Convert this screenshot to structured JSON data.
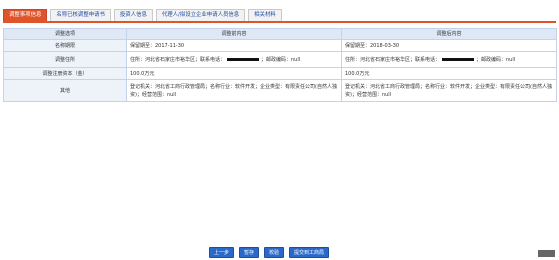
{
  "tabs": [
    {
      "label": "调整事项信息",
      "active": true
    },
    {
      "label": "名称已核调整申请书",
      "active": false
    },
    {
      "label": "投资人信息",
      "active": false
    },
    {
      "label": "代理人/拟设立企业申请人员信息",
      "active": false
    },
    {
      "label": "相关材料",
      "active": false
    }
  ],
  "table": {
    "col_item": "调整选项",
    "col_before": "调整前内容",
    "col_after": "调整后内容",
    "rows": [
      {
        "label": "名称期限",
        "before": "保留期至：2017-11-30",
        "after": "保留期至：2018-03-30"
      },
      {
        "label": "调整住所",
        "before_a": "住所：河北省石家庄市裕华区；联系电话：",
        "before_b": "；邮政编码：null",
        "after_a": "住所：河北省石家庄市裕华区；联系电话：",
        "after_b": "；邮政编码：null"
      },
      {
        "label": "调整注册资本（金）",
        "before": "100.0万元",
        "after": "100.0万元"
      },
      {
        "label": "其他",
        "before": "登记机关：河北省工商行政管理局；名称行业：软件开发；企业类型：有限责任公司(自然人独资)；经营范围：null",
        "after": "登记机关：河北省工商行政管理局；名称行业：软件开发；企业类型：有限责任公司(自然人独资)；经营范围：null"
      }
    ]
  },
  "actions": {
    "prev": "上一步",
    "save": "暂存",
    "check": "校验",
    "submit": "提交到工商局"
  },
  "colors": {
    "accent": "#e0542c",
    "button": "#2a68c9",
    "header_bg": "#dfe8f5"
  }
}
